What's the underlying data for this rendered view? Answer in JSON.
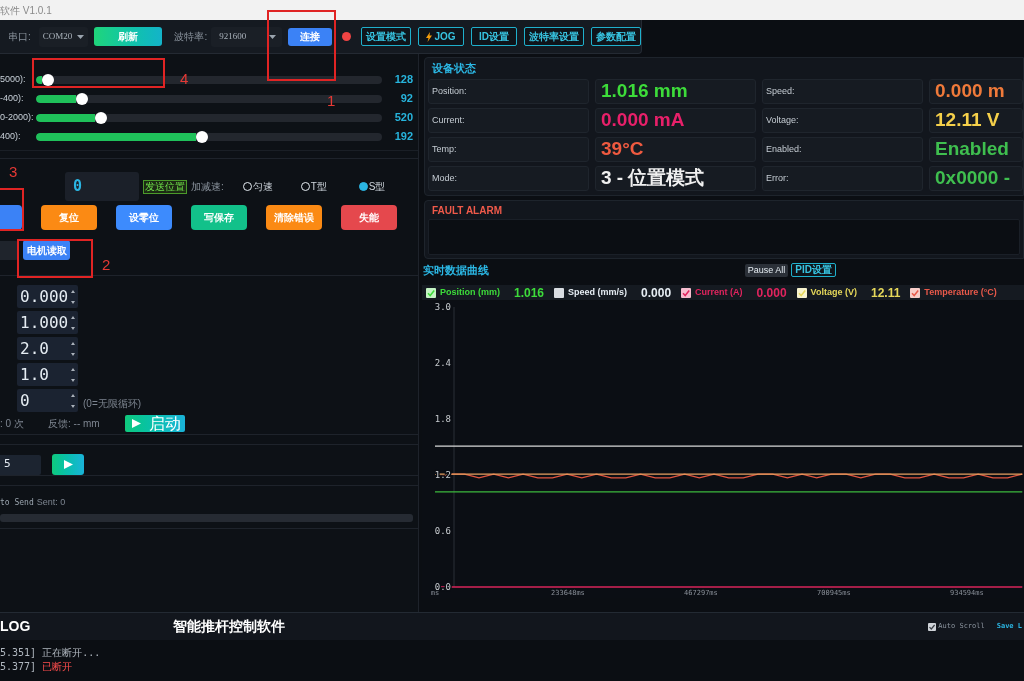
{
  "window": {
    "title": "软件 V1.0.1"
  },
  "toolbar": {
    "port_label": "串口:",
    "port": {
      "value": "COM20"
    },
    "refresh_button": "刷新",
    "baud_label": "波特率:",
    "baud": {
      "value": "921600"
    },
    "connect_button": "连接",
    "connected": false,
    "tool_buttons": [
      {
        "label": "设置模式",
        "kind": "text"
      },
      {
        "label": "JOG",
        "kind": "bolt"
      },
      {
        "label": "ID设置",
        "kind": "text"
      },
      {
        "label": "波特率设置",
        "kind": "text"
      },
      {
        "label": "参数配置",
        "kind": "text"
      }
    ]
  },
  "sliders": [
    {
      "label": "5000):",
      "level": 0.035,
      "reading": "128"
    },
    {
      "label": "-400):",
      "level": 0.133,
      "reading": "92"
    },
    {
      "label": "0-2000):",
      "level": 0.188,
      "reading": "520"
    },
    {
      "label": "400):",
      "level": 0.48,
      "reading": "192"
    }
  ],
  "position_command": {
    "value": "0",
    "send_button": "发送位置",
    "accel_label": "加减速:",
    "profiles": [
      {
        "label": "匀速",
        "selected": false
      },
      {
        "label": "T型",
        "selected": false
      },
      {
        "label": "S型",
        "selected": true
      }
    ]
  },
  "action_buttons": [
    {
      "color": "#3b82f6"
    },
    {
      "label": "复位",
      "color": "#fb8a14"
    },
    {
      "label": "设零位",
      "color": "#3d8bfd"
    },
    {
      "label": "写保存",
      "color": "#12c18a"
    },
    {
      "label": "清除错误",
      "color": "#fb8a14"
    },
    {
      "label": "失能",
      "color": "#e5484d"
    }
  ],
  "read_button": "电机读取",
  "motion_params": [
    {
      "value": "0.000"
    },
    {
      "value": "1.000"
    },
    {
      "value": "2.0"
    },
    {
      "value": "1.0"
    },
    {
      "value": "0",
      "hint": "(0=无限循环)"
    }
  ],
  "cycle_count": ": 0 次",
  "feedback": "反馈: -- mm",
  "start_button": "启动",
  "step": {
    "value": "5"
  },
  "auto_send": {
    "label": "to Send",
    "sent": "Sent: 0"
  },
  "device_status": {
    "title": "设备状态",
    "fields": [
      {
        "label": "Position:",
        "value": "1.016 mm",
        "color": "#3ddc3a"
      },
      {
        "label": "Speed:",
        "value": "0.000 m",
        "color": "#f07a3a"
      },
      {
        "label": "Current:",
        "value": "0.000 mA",
        "color": "#e8206a"
      },
      {
        "label": "Voltage:",
        "value": "12.11 V",
        "color": "#f5d04a"
      },
      {
        "label": "Temp:",
        "value": "39°C",
        "color": "#ef5a40"
      },
      {
        "label": "Enabled:",
        "value": "Enabled",
        "color": "#3fbf4f"
      },
      {
        "label": "Mode:",
        "value": "3 - 位置模式",
        "color": "#f0f0f0"
      },
      {
        "label": "Error:",
        "value": "0x0000 -",
        "color": "#3fbf4f"
      }
    ]
  },
  "fault_alarm": {
    "title": "FAULT ALARM"
  },
  "realtime_chart": {
    "title": "实时数据曲线",
    "pause_button": "Pause All",
    "pid_button": "PID设置",
    "legend": [
      {
        "label": "Position (mm)",
        "checked": true,
        "reading": "1.016",
        "color": "#3ddc3a"
      },
      {
        "label": "Speed (mm/s)",
        "checked": false,
        "reading": "0.000",
        "color": "#e6edf3"
      },
      {
        "label": "Current (A)",
        "checked": true,
        "reading": "0.000",
        "color": "#e0245e"
      },
      {
        "label": "Voltage (V)",
        "checked": true,
        "reading": "12.11",
        "color": "#e5d75a"
      },
      {
        "label": "Temperature (°C)",
        "checked": true,
        "color": "#e8594a"
      }
    ],
    "chart_data": {
      "type": "line",
      "x": [
        0,
        25800,
        51600,
        77400,
        103200,
        129000,
        154800,
        180600,
        206400,
        232200,
        258000,
        283800,
        309600,
        335400,
        361200,
        387000,
        412800,
        438600,
        464400,
        490200,
        516000,
        541800,
        567600,
        593400,
        619200,
        645000,
        670800,
        696600,
        722400,
        748200,
        774000,
        799800,
        825600,
        851400,
        877200,
        903000,
        928800,
        954600,
        980400,
        1006200,
        1032000
      ],
      "xlim": [
        0,
        1035000
      ],
      "ylim": [
        0,
        3
      ],
      "xticks": [
        {
          "value": 0,
          "label": "ms"
        },
        {
          "value": 233648,
          "label": "233648ms"
        },
        {
          "value": 467297,
          "label": "467297ms"
        },
        {
          "value": 700945,
          "label": "700945ms"
        },
        {
          "value": 934594,
          "label": "934594ms"
        }
      ],
      "yticks": [
        {
          "value": 0,
          "label": "0.0"
        },
        {
          "value": 0.6,
          "label": "0.6"
        },
        {
          "value": 1.2,
          "label": "1.2"
        },
        {
          "value": 1.8,
          "label": "1.8"
        },
        {
          "value": 2.4,
          "label": "2.4"
        },
        {
          "value": 3,
          "label": "3.0"
        }
      ],
      "series": [
        {
          "color": "#3cb83c",
          "values": [
            1.02,
            1.02,
            1.02,
            1.02,
            1.02,
            1.02,
            1.02,
            1.02,
            1.02,
            1.02,
            1.02,
            1.02,
            1.02,
            1.02,
            1.02,
            1.02,
            1.02,
            1.02,
            1.02,
            1.02,
            1.02,
            1.02,
            1.02,
            1.02,
            1.02,
            1.02,
            1.02,
            1.02,
            1.02,
            1.02,
            1.02,
            1.02,
            1.02,
            1.02,
            1.02,
            1.02,
            1.02,
            1.02,
            1.02,
            1.02,
            1.02
          ]
        },
        {
          "color": "#d9d9d9",
          "values": [
            1.51,
            1.51,
            1.51,
            1.51,
            1.51,
            1.51,
            1.51,
            1.51,
            1.51,
            1.51,
            1.51,
            1.51,
            1.51,
            1.51,
            1.51,
            1.51,
            1.51,
            1.51,
            1.51,
            1.51,
            1.51,
            1.51,
            1.51,
            1.51,
            1.51,
            1.51,
            1.51,
            1.51,
            1.51,
            1.51,
            1.51,
            1.51,
            1.51,
            1.51,
            1.51,
            1.51,
            1.51,
            1.51,
            1.51,
            1.51,
            1.51
          ]
        },
        {
          "color": "#e0553f",
          "values": [
            1.17,
            1.21,
            1.21,
            1.17,
            1.21,
            1.17,
            1.21,
            1.17,
            1.17,
            1.21,
            1.17,
            1.21,
            1.17,
            1.17,
            1.21,
            1.17,
            1.17,
            1.21,
            1.17,
            1.21,
            1.17,
            1.17,
            1.21,
            1.21,
            1.17,
            1.21,
            1.17,
            1.21,
            1.21,
            1.17,
            1.21,
            1.21,
            1.17,
            1.17,
            1.21,
            1.17,
            1.17,
            1.21,
            1.17,
            1.17,
            1.21
          ]
        },
        {
          "color": "#e8a060",
          "values": [
            1.21,
            1.21,
            1.21,
            1.21,
            1.21,
            1.21,
            1.21,
            1.21,
            1.21,
            1.21,
            1.21,
            1.21,
            1.21,
            1.21,
            1.21,
            1.21,
            1.21,
            1.21,
            1.21,
            1.21,
            1.21,
            1.21,
            1.21,
            1.21,
            1.21,
            1.21,
            1.21,
            1.21,
            1.21,
            1.21,
            1.21,
            1.21,
            1.21,
            1.21,
            1.21,
            1.21,
            1.21,
            1.21,
            1.21,
            1.21,
            1.21
          ]
        },
        {
          "color": "#d8245a",
          "values": [
            0,
            0,
            0,
            0,
            0,
            0,
            0,
            0,
            0,
            0,
            0,
            0,
            0,
            0,
            0,
            0,
            0,
            0,
            0,
            0,
            0,
            0,
            0,
            0,
            0,
            0,
            0,
            0,
            0,
            0,
            0,
            0,
            0,
            0,
            0,
            0,
            0,
            0,
            0,
            0,
            0
          ]
        }
      ]
    }
  },
  "log": {
    "title": "LOG",
    "app_title": "智能推杆控制软件",
    "auto_scroll": {
      "label": "Auto Scroll",
      "checked": true
    },
    "save_button": "Save L",
    "lines": [
      {
        "time": "5.351]",
        "message": "正在断开...",
        "kind": "info"
      },
      {
        "time": "5.377]",
        "message": "已断开",
        "kind": "error"
      }
    ]
  },
  "annotations": [
    {
      "label": "1"
    },
    {
      "label": "2"
    },
    {
      "label": "3"
    },
    {
      "label": "4"
    }
  ]
}
